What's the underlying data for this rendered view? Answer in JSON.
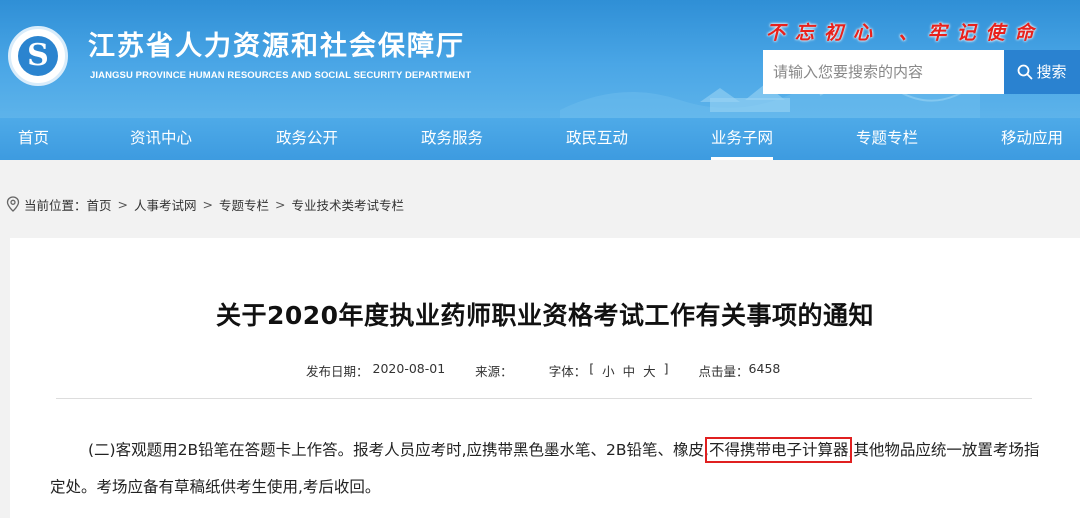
{
  "header": {
    "logo_glyph": "S",
    "site_title": "江苏省人力资源和社会保障厅",
    "site_subtitle": "JIANGSU PROVINCE HUMAN RESOURCES AND SOCIAL SECURITY DEPARTMENT",
    "slogan": "不忘初心 、牢记使命",
    "search": {
      "placeholder": "请输入您要搜索的内容",
      "button_label": "搜索",
      "icon": "search-icon"
    },
    "colors": {
      "header_blue": "#3d9be0",
      "search_button": "#2a82d0",
      "slogan_red": "#e8211c"
    }
  },
  "nav": {
    "items": [
      {
        "label": "首页"
      },
      {
        "label": "资讯中心"
      },
      {
        "label": "政务公开"
      },
      {
        "label": "政务服务"
      },
      {
        "label": "政民互动"
      },
      {
        "label": "业务子网",
        "active": true
      },
      {
        "label": "专题专栏"
      },
      {
        "label": "移动应用"
      }
    ]
  },
  "breadcrumb": {
    "icon": "location-pin-icon",
    "prefix": "当前位置：",
    "items": [
      "首页",
      "人事考试网",
      "专题专栏",
      "专业技术类考试专栏"
    ],
    "separator": ">"
  },
  "article": {
    "title": "关于2020年度执业药师职业资格考试工作有关事项的通知",
    "meta": {
      "date_label": "发布日期：",
      "date": "2020-08-01",
      "source_label": "来源：",
      "source": "",
      "font_label": "字体：",
      "font_open": "[",
      "font_small": "小",
      "font_medium": "中",
      "font_large": "大",
      "font_close": "]",
      "views_label": "点击量：",
      "views": "6458"
    },
    "paragraph": {
      "before": "(二)客观题用2B铅笔在答题卡上作答。报考人员应考时,应携带黑色墨水笔、2B铅笔、橡皮,",
      "highlighted": "不得携带电子计算器",
      "after": ",其他物品应统一放置考场指定处。考场应备有草稿纸供考生使用,考后收回。",
      "highlight_color": "#e02020"
    }
  }
}
